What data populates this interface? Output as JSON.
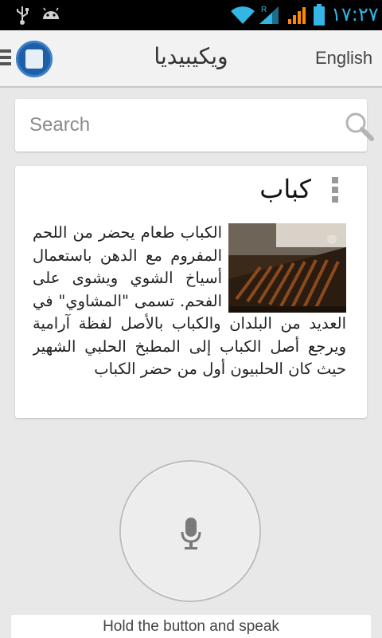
{
  "status_bar": {
    "time": "١٧:٢٧",
    "signal_label": "R",
    "accent_color": "#33b5e5",
    "icons": [
      "usb-icon",
      "android-debug-icon",
      "wifi-icon",
      "signal-icon",
      "signal-icon-2",
      "battery-icon"
    ]
  },
  "action_bar": {
    "title": "ويكيبيديا",
    "language_toggle": "English",
    "icons": [
      "menu-icon",
      "app-logo-icon"
    ]
  },
  "search": {
    "placeholder": "Search",
    "value": "",
    "icon": "search-icon"
  },
  "article": {
    "title": "كباب",
    "body": "الكباب طعام يحضر من اللحم المفروم مع الدهن باستعمال أسياخ الشوي ويشوى على الفحم. تسمى \"المشاوي\" في العديد من البلدان والكباب بالأصل لفظة آرامية ويرجع أصل الكباب إلى المطبخ الحلبي الشهير حيث كان الحلبيون أول من حضر الكباب",
    "image": "kebab-grill-photo",
    "menu_icon": "more-vert-icon"
  },
  "voice": {
    "icon": "microphone-icon",
    "hint": "Hold the button and speak"
  }
}
